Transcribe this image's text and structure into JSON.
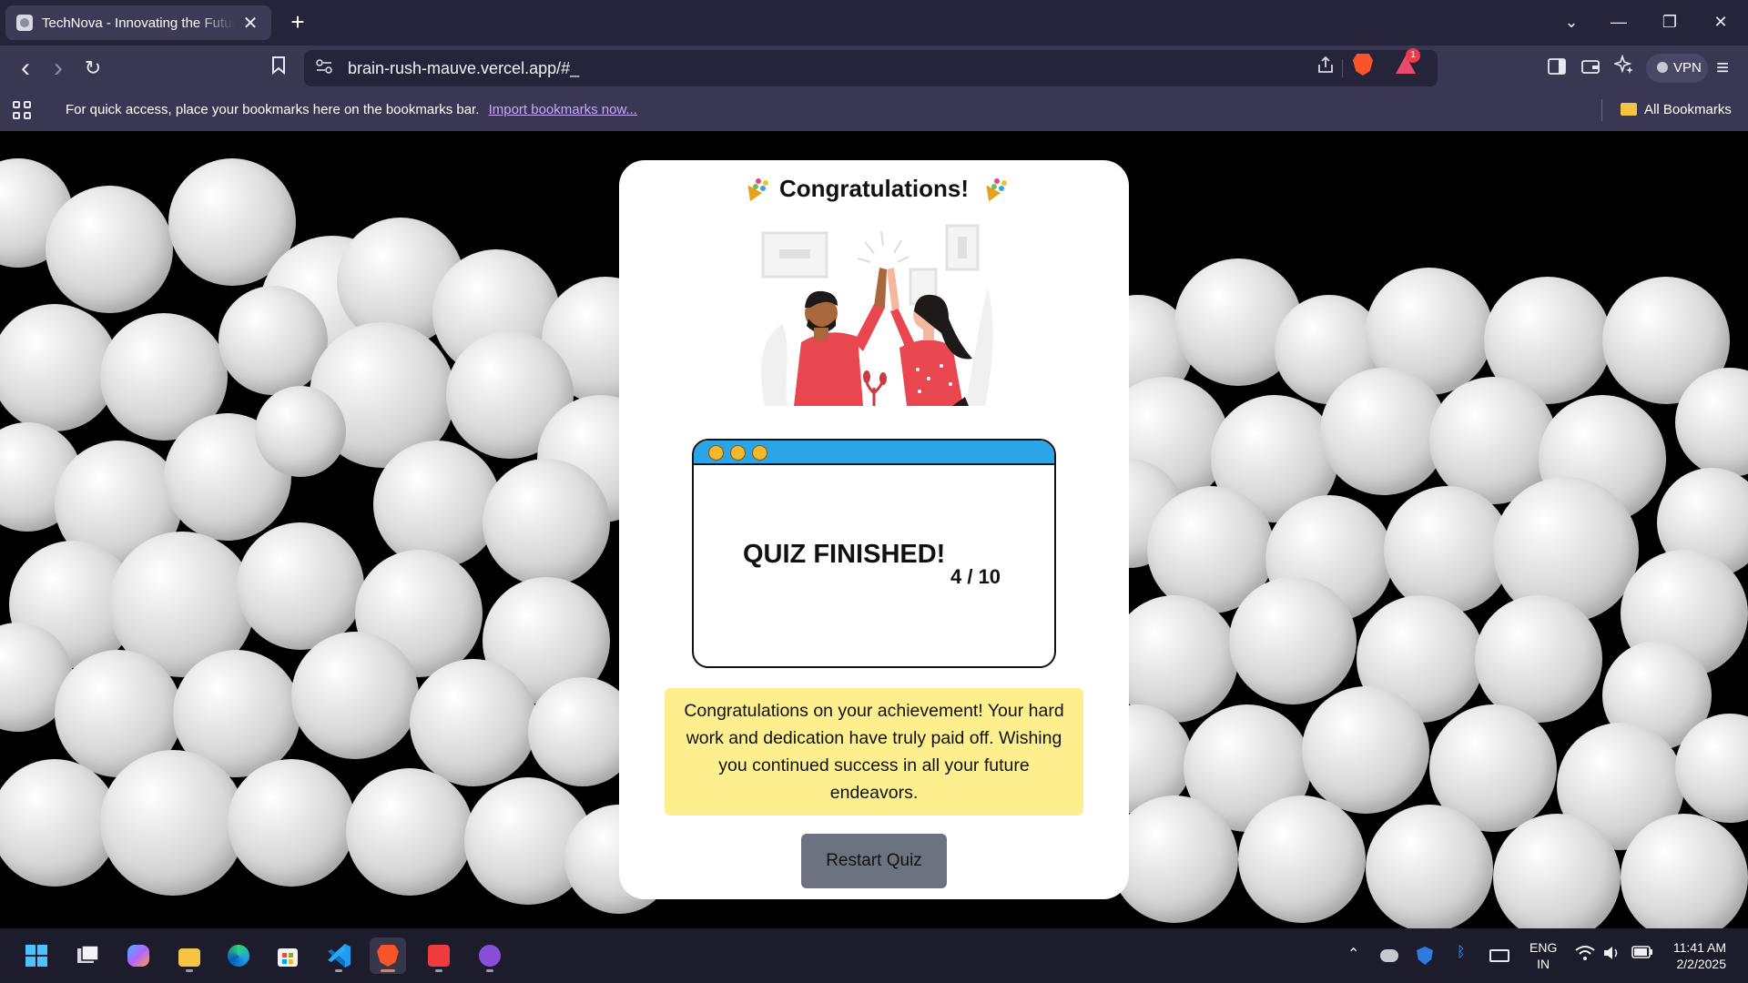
{
  "browser": {
    "tab_title": "TechNova - Innovating the Future",
    "tab_close": "✕",
    "new_tab": "+",
    "window_controls": {
      "tab_list": "⌄",
      "minimize": "—",
      "restore": "❐",
      "close": "✕"
    },
    "nav": {
      "back": "‹",
      "forward": "›",
      "reload": "↻",
      "bookmark": "🔖"
    },
    "url": "brain-rush-mauve.vercel.app/#_",
    "rewards_badge": "1",
    "vpn_label": "VPN",
    "bookmarks_bar": {
      "hint": "For quick access, place your bookmarks here on the bookmarks bar.",
      "import_link": "Import bookmarks now...",
      "all_bookmarks": "All Bookmarks"
    }
  },
  "quiz": {
    "title": "Congratulations!",
    "result_heading": "QUIZ FINISHED!",
    "score": "4 / 10",
    "score_value": 4,
    "score_total": 10,
    "message": "Congratulations on your achievement! Your hard work and dedication have truly paid off. Wishing you continued success in all your future endeavors.",
    "restart_label": "Restart Quiz"
  },
  "taskbar": {
    "apps": [
      "start",
      "task-view",
      "copilot",
      "file-explorer",
      "edge",
      "microsoft-store",
      "vscode",
      "brave",
      "anydesk",
      "github-desktop"
    ],
    "active_app": "brave",
    "language": "ENG",
    "region": "IN",
    "time": "11:41 AM",
    "date": "2/2/2025"
  },
  "colors": {
    "card_bg": "#ffffff",
    "message_bg": "#fdef8e",
    "window_titlebar": "#2aa6e8",
    "restart_button": "#6c7280",
    "balloon": "#d6d6d6"
  }
}
